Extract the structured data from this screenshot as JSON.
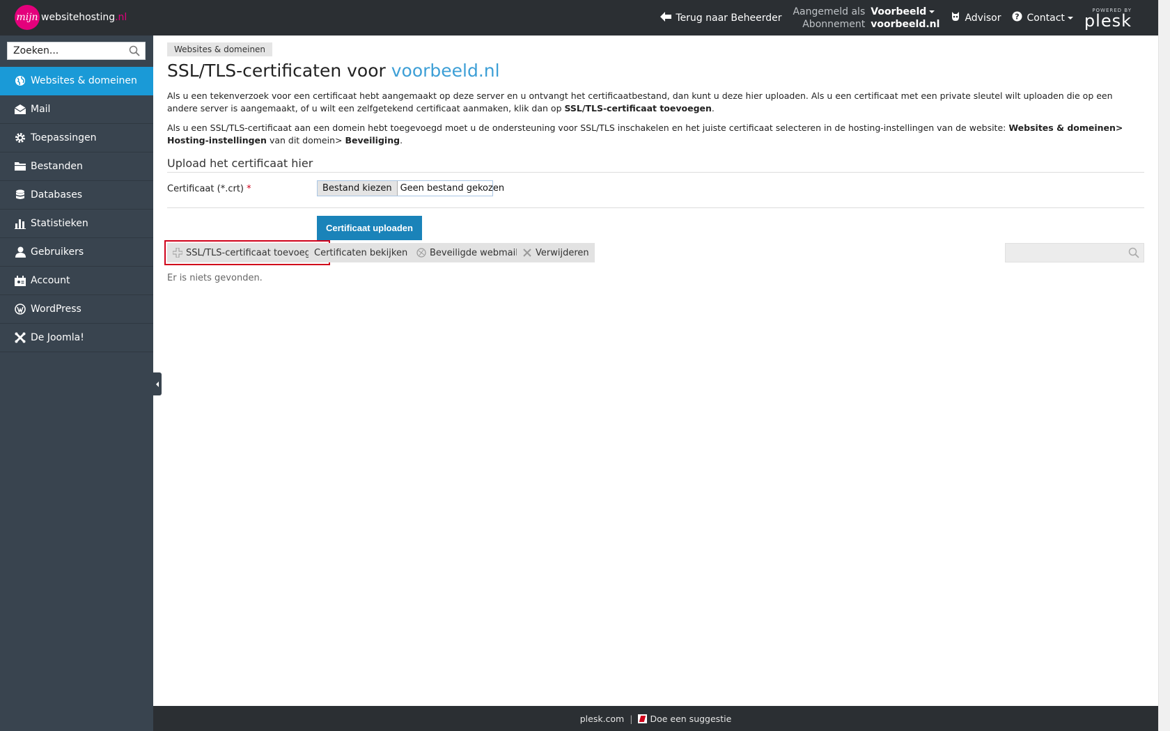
{
  "brand": {
    "logo_mark": "mijn",
    "name_main": "websitehosting",
    "name_tld": ".nl"
  },
  "topbar": {
    "back_label": "Terug naar Beheerder",
    "logged_in_label": "Aangemeld als",
    "logged_in_value": "Voorbeeld",
    "subscription_label": "Abonnement",
    "subscription_value": "voorbeeld.nl",
    "advisor_label": "Advisor",
    "contact_label": "Contact",
    "powered_by": "POWERED BY",
    "plesk": "plesk"
  },
  "sidebar": {
    "search_placeholder": "Zoeken...",
    "items": [
      {
        "label": "Websites & domeinen",
        "icon": "globe-icon",
        "active": true
      },
      {
        "label": "Mail",
        "icon": "envelope-icon"
      },
      {
        "label": "Toepassingen",
        "icon": "gear-icon"
      },
      {
        "label": "Bestanden",
        "icon": "folder-icon"
      },
      {
        "label": "Databases",
        "icon": "database-icon"
      },
      {
        "label": "Statistieken",
        "icon": "bar-chart-icon"
      },
      {
        "label": "Gebruikers",
        "icon": "user-icon"
      },
      {
        "label": "Account",
        "icon": "account-icon"
      },
      {
        "label": "WordPress",
        "icon": "wordpress-icon"
      },
      {
        "label": "De Joomla!",
        "icon": "joomla-icon"
      }
    ]
  },
  "main": {
    "breadcrumb": "Websites & domeinen",
    "title_prefix": "SSL/TLS-certificaten voor",
    "title_domain": "voorbeeld.nl",
    "intro1_text": "Als u een tekenverzoek voor een certificaat hebt aangemaakt op deze server en u ontvangt het certificaatbestand, dan kunt u deze hier uploaden. Als u een certificaat met een private sleutel wilt uploaden die op een andere server is aangemaakt, of u wilt een zelfgetekend certificaat aanmaken, klik dan op",
    "intro1_bold": "SSL/TLS-certificaat toevoegen",
    "intro2_text": "Als u een SSL/TLS-certificaat aan een domein hebt toegevoegd moet u de ondersteuning voor SSL/TLS inschakelen en het juiste certificaat selecteren in de hosting-instellingen van de website:",
    "intro2_bold1": "Websites & domeinen> Hosting-instellingen",
    "intro2_mid": "van dit domein>",
    "intro2_bold2": "Beveiliging",
    "section_title": "Upload het certificaat hier",
    "cert_label": "Certificaat (*.crt)",
    "required_mark": "*",
    "file_button": "Bestand kiezen",
    "file_status": "Geen bestand gekozen",
    "upload_button": "Certificaat uploaden",
    "toolbar": {
      "add": "SSL/TLS-certificaat toevoegen",
      "view": "Certificaten bekijken",
      "webmail": "Beveiligde webmail",
      "delete": "Verwijderen"
    },
    "empty_message": "Er is niets gevonden."
  },
  "footer": {
    "link1": "plesk.com",
    "separator": "|",
    "link2": "Doe een suggestie"
  },
  "colors": {
    "topbar": "#2b2f33",
    "sidebar": "#39444f",
    "active": "#1a9ad7",
    "upload_button": "#1a83b9",
    "brand_pink": "#e4007c",
    "highlight_red": "#d0021b"
  }
}
